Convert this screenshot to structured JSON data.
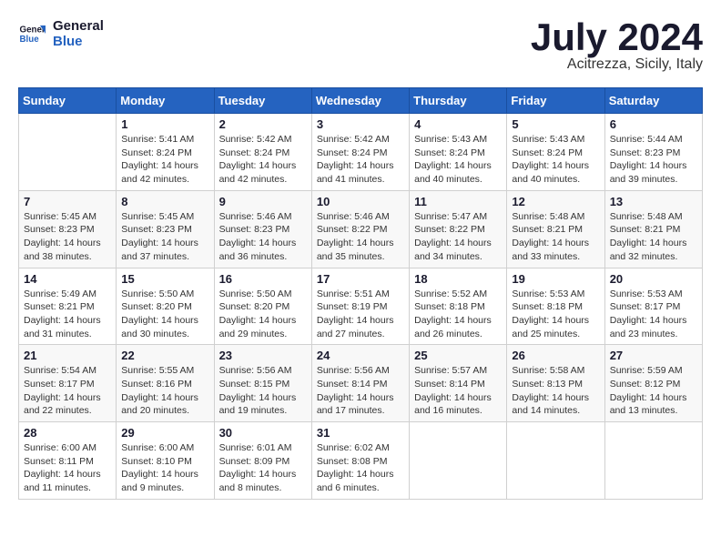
{
  "header": {
    "logo_line1": "General",
    "logo_line2": "Blue",
    "title": "July 2024",
    "subtitle": "Acitrezza, Sicily, Italy"
  },
  "calendar": {
    "days_of_week": [
      "Sunday",
      "Monday",
      "Tuesday",
      "Wednesday",
      "Thursday",
      "Friday",
      "Saturday"
    ],
    "weeks": [
      [
        {
          "day": "",
          "sunrise": "",
          "sunset": "",
          "daylight": ""
        },
        {
          "day": "1",
          "sunrise": "Sunrise: 5:41 AM",
          "sunset": "Sunset: 8:24 PM",
          "daylight": "Daylight: 14 hours and 42 minutes."
        },
        {
          "day": "2",
          "sunrise": "Sunrise: 5:42 AM",
          "sunset": "Sunset: 8:24 PM",
          "daylight": "Daylight: 14 hours and 42 minutes."
        },
        {
          "day": "3",
          "sunrise": "Sunrise: 5:42 AM",
          "sunset": "Sunset: 8:24 PM",
          "daylight": "Daylight: 14 hours and 41 minutes."
        },
        {
          "day": "4",
          "sunrise": "Sunrise: 5:43 AM",
          "sunset": "Sunset: 8:24 PM",
          "daylight": "Daylight: 14 hours and 40 minutes."
        },
        {
          "day": "5",
          "sunrise": "Sunrise: 5:43 AM",
          "sunset": "Sunset: 8:24 PM",
          "daylight": "Daylight: 14 hours and 40 minutes."
        },
        {
          "day": "6",
          "sunrise": "Sunrise: 5:44 AM",
          "sunset": "Sunset: 8:23 PM",
          "daylight": "Daylight: 14 hours and 39 minutes."
        }
      ],
      [
        {
          "day": "7",
          "sunrise": "Sunrise: 5:45 AM",
          "sunset": "Sunset: 8:23 PM",
          "daylight": "Daylight: 14 hours and 38 minutes."
        },
        {
          "day": "8",
          "sunrise": "Sunrise: 5:45 AM",
          "sunset": "Sunset: 8:23 PM",
          "daylight": "Daylight: 14 hours and 37 minutes."
        },
        {
          "day": "9",
          "sunrise": "Sunrise: 5:46 AM",
          "sunset": "Sunset: 8:23 PM",
          "daylight": "Daylight: 14 hours and 36 minutes."
        },
        {
          "day": "10",
          "sunrise": "Sunrise: 5:46 AM",
          "sunset": "Sunset: 8:22 PM",
          "daylight": "Daylight: 14 hours and 35 minutes."
        },
        {
          "day": "11",
          "sunrise": "Sunrise: 5:47 AM",
          "sunset": "Sunset: 8:22 PM",
          "daylight": "Daylight: 14 hours and 34 minutes."
        },
        {
          "day": "12",
          "sunrise": "Sunrise: 5:48 AM",
          "sunset": "Sunset: 8:21 PM",
          "daylight": "Daylight: 14 hours and 33 minutes."
        },
        {
          "day": "13",
          "sunrise": "Sunrise: 5:48 AM",
          "sunset": "Sunset: 8:21 PM",
          "daylight": "Daylight: 14 hours and 32 minutes."
        }
      ],
      [
        {
          "day": "14",
          "sunrise": "Sunrise: 5:49 AM",
          "sunset": "Sunset: 8:21 PM",
          "daylight": "Daylight: 14 hours and 31 minutes."
        },
        {
          "day": "15",
          "sunrise": "Sunrise: 5:50 AM",
          "sunset": "Sunset: 8:20 PM",
          "daylight": "Daylight: 14 hours and 30 minutes."
        },
        {
          "day": "16",
          "sunrise": "Sunrise: 5:50 AM",
          "sunset": "Sunset: 8:20 PM",
          "daylight": "Daylight: 14 hours and 29 minutes."
        },
        {
          "day": "17",
          "sunrise": "Sunrise: 5:51 AM",
          "sunset": "Sunset: 8:19 PM",
          "daylight": "Daylight: 14 hours and 27 minutes."
        },
        {
          "day": "18",
          "sunrise": "Sunrise: 5:52 AM",
          "sunset": "Sunset: 8:18 PM",
          "daylight": "Daylight: 14 hours and 26 minutes."
        },
        {
          "day": "19",
          "sunrise": "Sunrise: 5:53 AM",
          "sunset": "Sunset: 8:18 PM",
          "daylight": "Daylight: 14 hours and 25 minutes."
        },
        {
          "day": "20",
          "sunrise": "Sunrise: 5:53 AM",
          "sunset": "Sunset: 8:17 PM",
          "daylight": "Daylight: 14 hours and 23 minutes."
        }
      ],
      [
        {
          "day": "21",
          "sunrise": "Sunrise: 5:54 AM",
          "sunset": "Sunset: 8:17 PM",
          "daylight": "Daylight: 14 hours and 22 minutes."
        },
        {
          "day": "22",
          "sunrise": "Sunrise: 5:55 AM",
          "sunset": "Sunset: 8:16 PM",
          "daylight": "Daylight: 14 hours and 20 minutes."
        },
        {
          "day": "23",
          "sunrise": "Sunrise: 5:56 AM",
          "sunset": "Sunset: 8:15 PM",
          "daylight": "Daylight: 14 hours and 19 minutes."
        },
        {
          "day": "24",
          "sunrise": "Sunrise: 5:56 AM",
          "sunset": "Sunset: 8:14 PM",
          "daylight": "Daylight: 14 hours and 17 minutes."
        },
        {
          "day": "25",
          "sunrise": "Sunrise: 5:57 AM",
          "sunset": "Sunset: 8:14 PM",
          "daylight": "Daylight: 14 hours and 16 minutes."
        },
        {
          "day": "26",
          "sunrise": "Sunrise: 5:58 AM",
          "sunset": "Sunset: 8:13 PM",
          "daylight": "Daylight: 14 hours and 14 minutes."
        },
        {
          "day": "27",
          "sunrise": "Sunrise: 5:59 AM",
          "sunset": "Sunset: 8:12 PM",
          "daylight": "Daylight: 14 hours and 13 minutes."
        }
      ],
      [
        {
          "day": "28",
          "sunrise": "Sunrise: 6:00 AM",
          "sunset": "Sunset: 8:11 PM",
          "daylight": "Daylight: 14 hours and 11 minutes."
        },
        {
          "day": "29",
          "sunrise": "Sunrise: 6:00 AM",
          "sunset": "Sunset: 8:10 PM",
          "daylight": "Daylight: 14 hours and 9 minutes."
        },
        {
          "day": "30",
          "sunrise": "Sunrise: 6:01 AM",
          "sunset": "Sunset: 8:09 PM",
          "daylight": "Daylight: 14 hours and 8 minutes."
        },
        {
          "day": "31",
          "sunrise": "Sunrise: 6:02 AM",
          "sunset": "Sunset: 8:08 PM",
          "daylight": "Daylight: 14 hours and 6 minutes."
        },
        {
          "day": "",
          "sunrise": "",
          "sunset": "",
          "daylight": ""
        },
        {
          "day": "",
          "sunrise": "",
          "sunset": "",
          "daylight": ""
        },
        {
          "day": "",
          "sunrise": "",
          "sunset": "",
          "daylight": ""
        }
      ]
    ]
  }
}
